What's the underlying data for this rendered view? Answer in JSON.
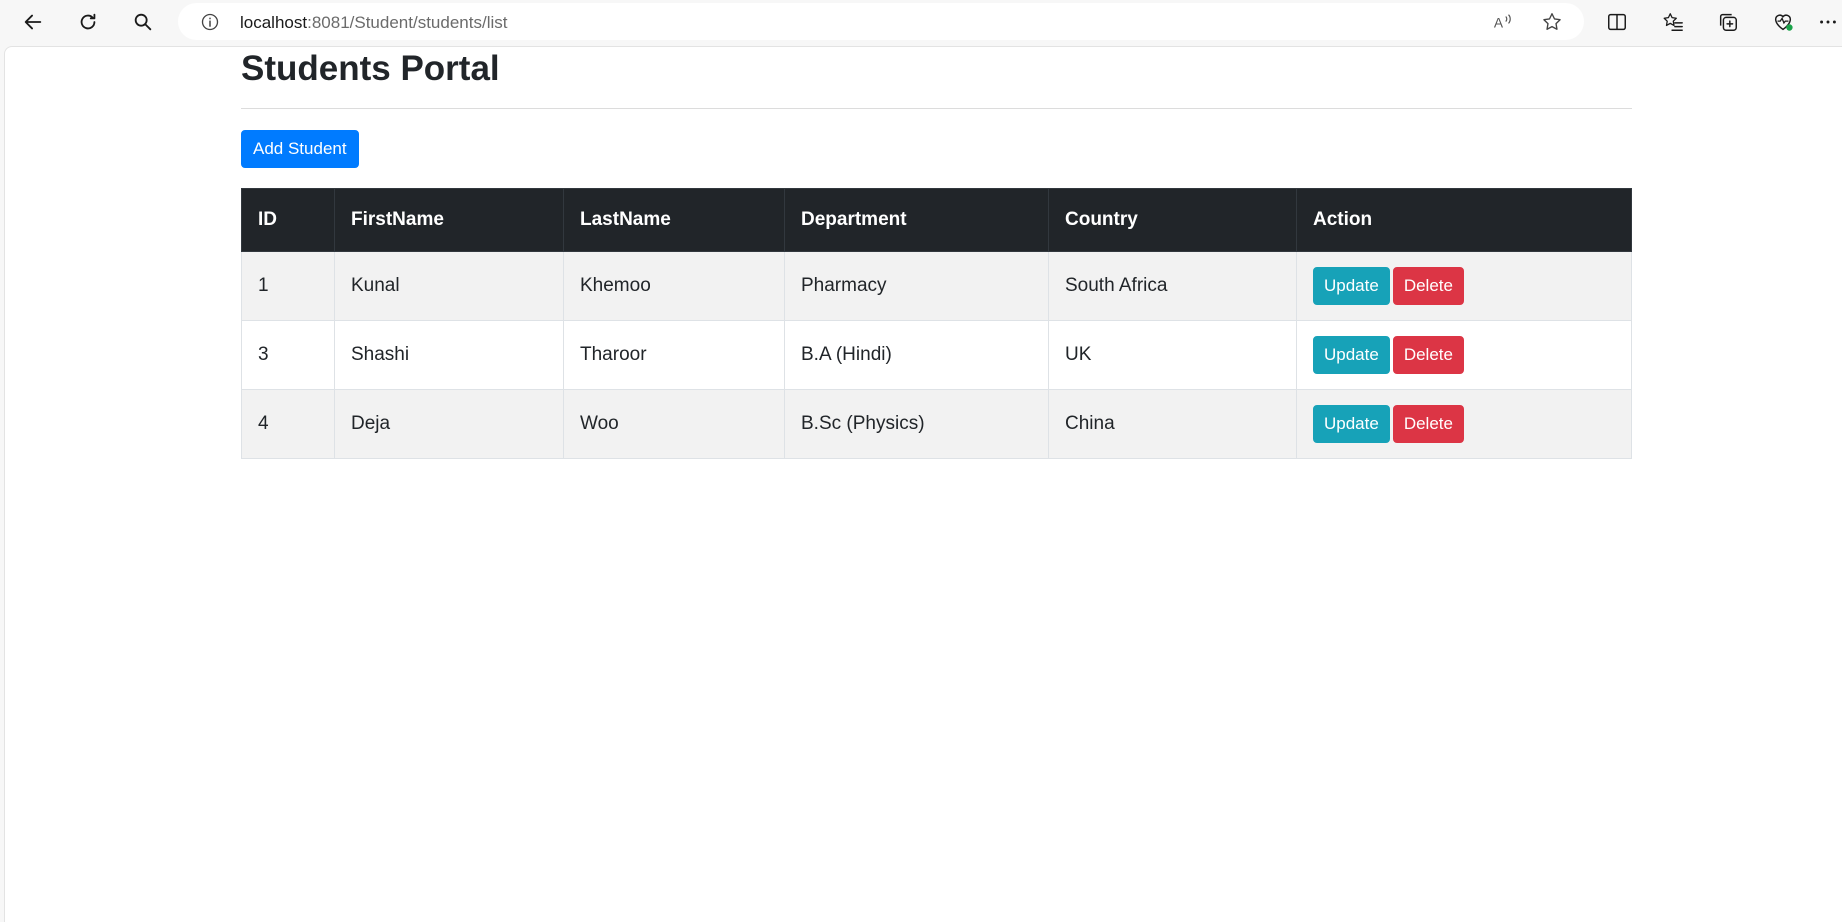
{
  "browser": {
    "url_host": "localhost",
    "url_rest": ":8081/Student/students/list"
  },
  "page": {
    "title": "Students Portal",
    "add_button_label": "Add Student"
  },
  "table": {
    "headers": [
      "ID",
      "FirstName",
      "LastName",
      "Department",
      "Country",
      "Action"
    ],
    "rows": [
      {
        "id": "1",
        "first": "Kunal",
        "last": "Khemoo",
        "dept": "Pharmacy",
        "country": "South Africa"
      },
      {
        "id": "3",
        "first": "Shashi",
        "last": "Tharoor",
        "dept": "B.A (Hindi)",
        "country": "UK"
      },
      {
        "id": "4",
        "first": "Deja",
        "last": "Woo",
        "dept": "B.Sc (Physics)",
        "country": "China"
      }
    ],
    "update_label": "Update",
    "delete_label": "Delete"
  },
  "colors": {
    "primary": "#007bff",
    "info": "#17a2b8",
    "danger": "#dc3545",
    "dark": "#212529"
  }
}
